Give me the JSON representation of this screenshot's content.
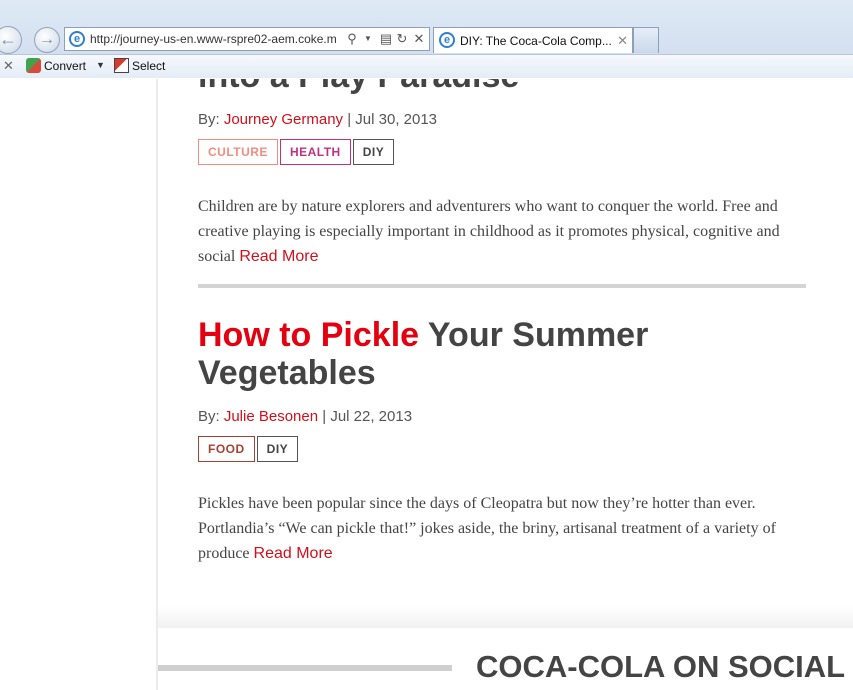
{
  "browser": {
    "url": "http://journey-us-en.www-rspre02-aem.coke.m",
    "tab_title": "DIY: The Coca-Cola Comp...",
    "toolbar": {
      "convert_label": "Convert",
      "select_label": "Select"
    }
  },
  "articles": [
    {
      "title_red": "",
      "title_rest": "into a Play Paradise",
      "by_label": "By: ",
      "author": "Journey Germany",
      "separator": " | ",
      "date": "Jul 30, 2013",
      "tags": [
        "CULTURE",
        "HEALTH",
        "DIY"
      ],
      "excerpt": "Children are by nature explorers and adventurers who want to conquer the world. Free and creative playing is especially important in childhood as it promotes physical, cognitive and social ",
      "read_more": "Read More"
    },
    {
      "title_red": "How to Pickle",
      "title_rest": " Your Summer Vegetables",
      "by_label": "By: ",
      "author": "Julie Besonen",
      "separator": " | ",
      "date": "Jul 22, 2013",
      "tags": [
        "FOOD",
        "DIY"
      ],
      "excerpt": "Pickles have been popular since the days of Cleopatra but now they’re hotter than ever. Portlandia’s “We can pickle that!” jokes aside, the briny, artisanal treatment of a variety of produce ",
      "read_more": "Read More"
    }
  ],
  "social": {
    "title": "COCA-COLA ON SOCIAL"
  },
  "colors": {
    "brand_red": "#e4000f",
    "link_red": "#d0101b",
    "text": "#444444"
  }
}
